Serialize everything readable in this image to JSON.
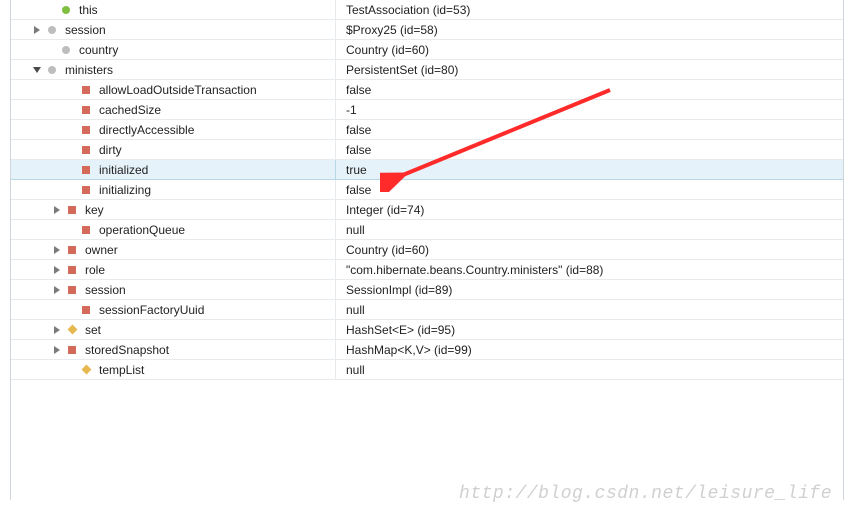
{
  "watermark": "http://blog.csdn.net/leisure_life",
  "rows": [
    {
      "indent": 34,
      "arrow": "none",
      "icon": "green-dot",
      "name": "this",
      "value": "TestAssociation  (id=53)",
      "selected": false
    },
    {
      "indent": 20,
      "arrow": "collapsed",
      "icon": "grey-dot",
      "name": "session",
      "value": "$Proxy25  (id=58)",
      "selected": false
    },
    {
      "indent": 34,
      "arrow": "none",
      "icon": "grey-dot",
      "name": "country",
      "value": "Country  (id=60)",
      "selected": false
    },
    {
      "indent": 20,
      "arrow": "expanded",
      "icon": "grey-dot",
      "name": "ministers",
      "value": "PersistentSet  (id=80)",
      "selected": false
    },
    {
      "indent": 54,
      "arrow": "none",
      "icon": "red-sq",
      "name": "allowLoadOutsideTransaction",
      "value": "false",
      "selected": false
    },
    {
      "indent": 54,
      "arrow": "none",
      "icon": "red-sq",
      "name": "cachedSize",
      "value": "-1",
      "selected": false
    },
    {
      "indent": 54,
      "arrow": "none",
      "icon": "red-sq",
      "name": "directlyAccessible",
      "value": "false",
      "selected": false
    },
    {
      "indent": 54,
      "arrow": "none",
      "icon": "red-sq",
      "name": "dirty",
      "value": "false",
      "selected": false
    },
    {
      "indent": 54,
      "arrow": "none",
      "icon": "red-sq",
      "name": "initialized",
      "value": "true",
      "selected": true
    },
    {
      "indent": 54,
      "arrow": "none",
      "icon": "red-sq",
      "name": "initializing",
      "value": "false",
      "selected": false
    },
    {
      "indent": 40,
      "arrow": "collapsed",
      "icon": "red-sq",
      "name": "key",
      "value": "Integer  (id=74)",
      "selected": false
    },
    {
      "indent": 54,
      "arrow": "none",
      "icon": "red-sq",
      "name": "operationQueue",
      "value": "null",
      "selected": false
    },
    {
      "indent": 40,
      "arrow": "collapsed",
      "icon": "red-sq",
      "name": "owner",
      "value": "Country  (id=60)",
      "selected": false
    },
    {
      "indent": 40,
      "arrow": "collapsed",
      "icon": "red-sq",
      "name": "role",
      "value": "\"com.hibernate.beans.Country.ministers\" (id=88)",
      "selected": false
    },
    {
      "indent": 40,
      "arrow": "collapsed",
      "icon": "red-sq",
      "name": "session",
      "value": "SessionImpl  (id=89)",
      "selected": false
    },
    {
      "indent": 54,
      "arrow": "none",
      "icon": "red-sq",
      "name": "sessionFactoryUuid",
      "value": "null",
      "selected": false
    },
    {
      "indent": 40,
      "arrow": "collapsed",
      "icon": "gold-di",
      "name": "set",
      "value": "HashSet<E>  (id=95)",
      "selected": false
    },
    {
      "indent": 40,
      "arrow": "collapsed",
      "icon": "red-sq",
      "name": "storedSnapshot",
      "value": "HashMap<K,V>  (id=99)",
      "selected": false
    },
    {
      "indent": 54,
      "arrow": "none",
      "icon": "gold-di",
      "name": "tempList",
      "value": "null",
      "selected": false
    }
  ]
}
